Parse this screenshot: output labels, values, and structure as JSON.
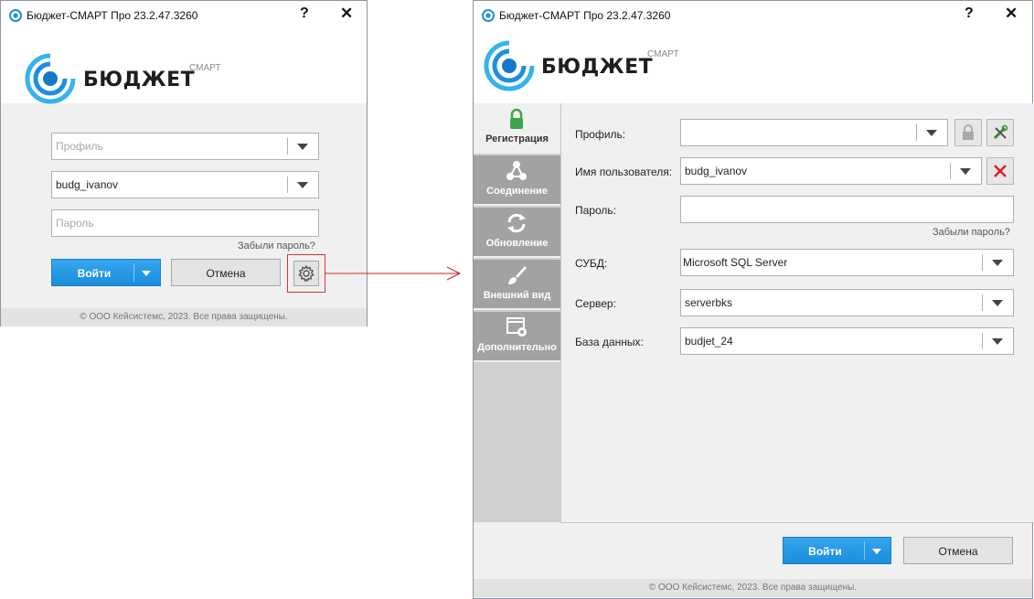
{
  "small_window": {
    "title": "Бюджет-СМАРТ Про 23.2.47.3260",
    "help_label": "?",
    "close_label": "✕",
    "brand": {
      "word": "БЮДЖЕТ",
      "sup": "СМАРТ"
    },
    "profile_placeholder": "Профиль",
    "username_value": "budg_ivanov",
    "password_placeholder": "Пароль",
    "forgot_password": "Забыли пароль?",
    "login_button": "Войти",
    "cancel_button": "Отмена",
    "settings_icon": "gear-icon",
    "footer": "© ООО Кейсистемс, 2023. Все права защищены."
  },
  "large_window": {
    "title": "Бюджет-СМАРТ Про 23.2.47.3260",
    "help_label": "?",
    "close_label": "✕",
    "brand": {
      "word": "БЮДЖЕТ",
      "sup": "СМАРТ"
    },
    "tabs": [
      {
        "label": "Регистрация",
        "icon": "lock-icon",
        "active": true
      },
      {
        "label": "Соединение",
        "icon": "network-icon",
        "active": false
      },
      {
        "label": "Обновление",
        "icon": "refresh-icon",
        "active": false
      },
      {
        "label": "Внешний вид",
        "icon": "brush-icon",
        "active": false
      },
      {
        "label": "Дополнительно",
        "icon": "window-gear-icon",
        "active": false
      }
    ],
    "fields": {
      "profile_label": "Профиль:",
      "profile_value": "",
      "username_label": "Имя пользователя:",
      "username_value": "budg_ivanov",
      "password_label": "Пароль:",
      "password_value": "",
      "forgot_password": "Забыли пароль?",
      "dbms_label": "СУБД:",
      "dbms_value": "Microsoft SQL Server",
      "server_label": "Сервер:",
      "server_value": "serverbks",
      "database_label": "База данных:",
      "database_value": "budjet_24"
    },
    "login_button": "Войти",
    "cancel_button": "Отмена",
    "footer": "© ООО Кейсистемс, 2023. Все права защищены."
  },
  "colors": {
    "primary_button": "#1b8ddc",
    "callout": "#cc2222",
    "tab_inactive": "#a2a2a2",
    "brand_blue": "#1e8fe0"
  }
}
